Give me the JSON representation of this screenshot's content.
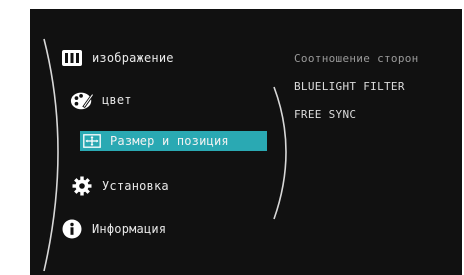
{
  "menu": {
    "items": [
      {
        "label": "изображение",
        "icon": "image-icon"
      },
      {
        "label": "цвет",
        "icon": "palette-icon"
      },
      {
        "label": "Размер и позиция",
        "icon": "resize-position-icon",
        "selected": true
      },
      {
        "label": "Установка",
        "icon": "gear-icon"
      },
      {
        "label": "Информация",
        "icon": "info-icon"
      }
    ]
  },
  "submenu": {
    "items": [
      {
        "label": "Соотношение сторон",
        "dim": true
      },
      {
        "label": "BLUELIGHT FILTER"
      },
      {
        "label": "FREE SYNC"
      }
    ]
  },
  "colors": {
    "background": "#111111",
    "highlight": "#2aa9b3",
    "text": "#e8e8e8"
  }
}
